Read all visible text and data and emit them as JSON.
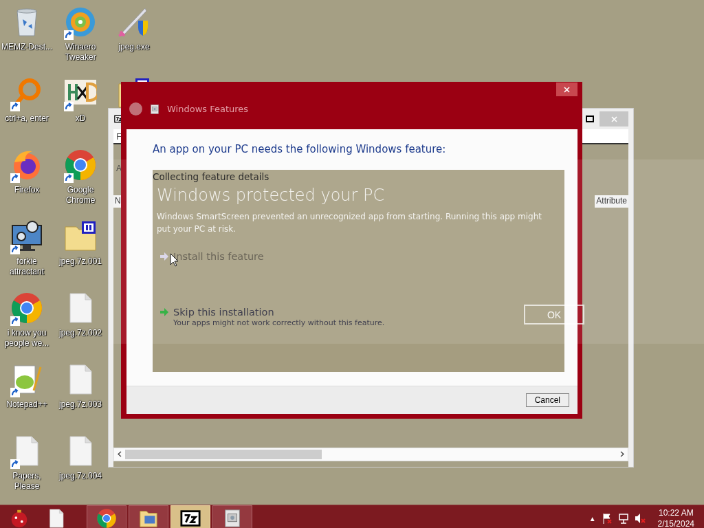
{
  "desktop_icons": [
    {
      "label": "MEMZ-Dest...",
      "kind": "recycle-bin",
      "shortcut": false
    },
    {
      "label": "ctrl+a, enter",
      "kind": "magnifier",
      "shortcut": true
    },
    {
      "label": "Firefox",
      "kind": "fox-globe",
      "shortcut": true
    },
    {
      "label": "forkie attractant",
      "kind": "monitor-gears",
      "shortcut": true
    },
    {
      "label": "i know you people we...",
      "kind": "browser",
      "shortcut": true
    },
    {
      "label": "Notepad++",
      "kind": "notepad",
      "shortcut": true
    },
    {
      "label": "Papers, Please",
      "kind": "file",
      "shortcut": true
    },
    {
      "label": "Winaero Tweaker",
      "kind": "swirl",
      "shortcut": true
    },
    {
      "label": "xD",
      "kind": "letters",
      "shortcut": true
    },
    {
      "label": "Google Chrome",
      "kind": "browser",
      "shortcut": true
    },
    {
      "label": "jpeg.7z.001",
      "kind": "folder-archive",
      "shortcut": false
    },
    {
      "label": "jpeg.7z.002",
      "kind": "file",
      "shortcut": false
    },
    {
      "label": "jpeg.7z.003",
      "kind": "file",
      "shortcut": false
    },
    {
      "label": "jpeg.7z.004",
      "kind": "file",
      "shortcut": false
    },
    {
      "label": "jpeg.exe",
      "kind": "sword-shield",
      "shortcut": false
    },
    {
      "kind": "folder-archive"
    }
  ],
  "background_window": {
    "menu": "F",
    "address": "A",
    "columns": [
      "N",
      "Attribute"
    ]
  },
  "smartscreen": {
    "title": "Windows protected your PC",
    "message": "Windows SmartScreen prevented an unrecognized app from starting. Running this app might put your PC at risk.",
    "button": "OK"
  },
  "dialog": {
    "title": "Windows Features",
    "heading": "An app on your PC needs the following Windows feature:",
    "status": "Collecting feature details",
    "options": [
      {
        "label": "Install this feature",
        "disabled": true
      },
      {
        "label": "Skip this installation",
        "description": "Your apps might not work correctly without this feature.",
        "disabled": false
      }
    ],
    "buttons": [
      "Cancel"
    ]
  },
  "taskbar": {
    "items": [
      {
        "kind": "ornament",
        "open": false,
        "selected": false
      },
      {
        "kind": "file",
        "open": false,
        "selected": false
      },
      {
        "kind": "browser",
        "open": true,
        "selected": false
      },
      {
        "kind": "folder",
        "open": true,
        "selected": false
      },
      {
        "kind": "archiver",
        "open": true,
        "selected": true
      },
      {
        "kind": "features",
        "open": true,
        "selected": false
      }
    ],
    "tray": {
      "caret": "▲"
    },
    "clock": {
      "time": "10:22 AM",
      "date": "2/15/2024"
    }
  }
}
